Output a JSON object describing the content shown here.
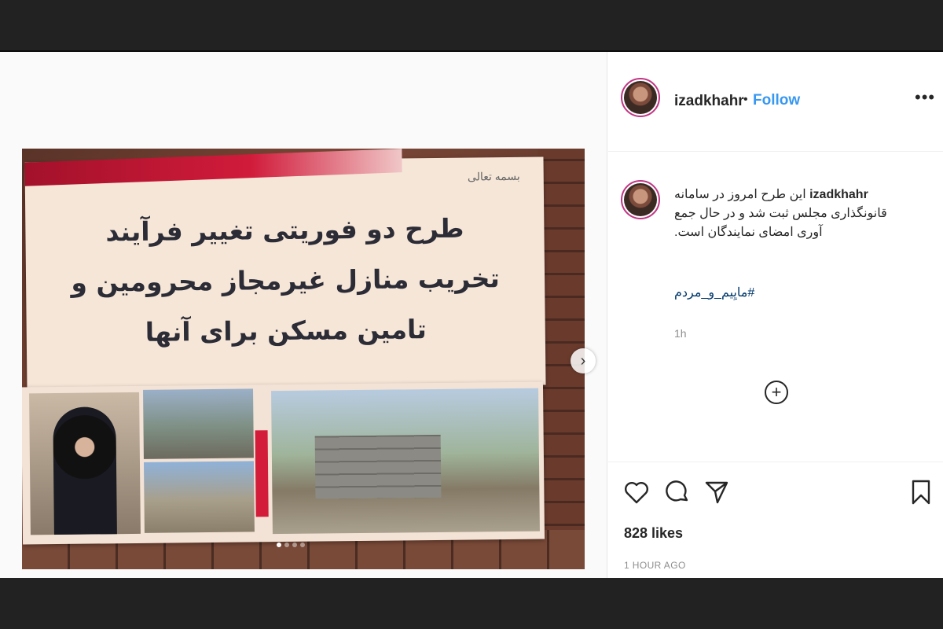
{
  "post": {
    "card": {
      "bismillah": "بسمه تعالی",
      "headline_line1": "طرح دو فوریتی تغییر فرآیند",
      "headline_line2": "تخریب منازل غیرمجاز محرومین و",
      "headline_line3": "تامین مسکن برای آنها"
    },
    "carousel": {
      "slide_count": 4,
      "active_index": 0
    }
  },
  "side": {
    "header": {
      "username": "izadkhahr",
      "separator": "•",
      "follow_label": "Follow",
      "more_label": "•••"
    },
    "caption": {
      "username": "izadkhahr",
      "text": "این طرح امروز در سامانه قانونگذاری مجلس ثبت شد و در حال جمع آوری امضای نمایندگان است.",
      "hashtag": "#مایِیم_و_مردم",
      "time": "1h"
    },
    "load_more_label": "+",
    "likes": "828 likes",
    "posted_ago": "1 HOUR AGO"
  },
  "colors": {
    "follow": "#3897f0",
    "accent_red": "#d11b3b",
    "avatar_ring": "#c13584"
  }
}
